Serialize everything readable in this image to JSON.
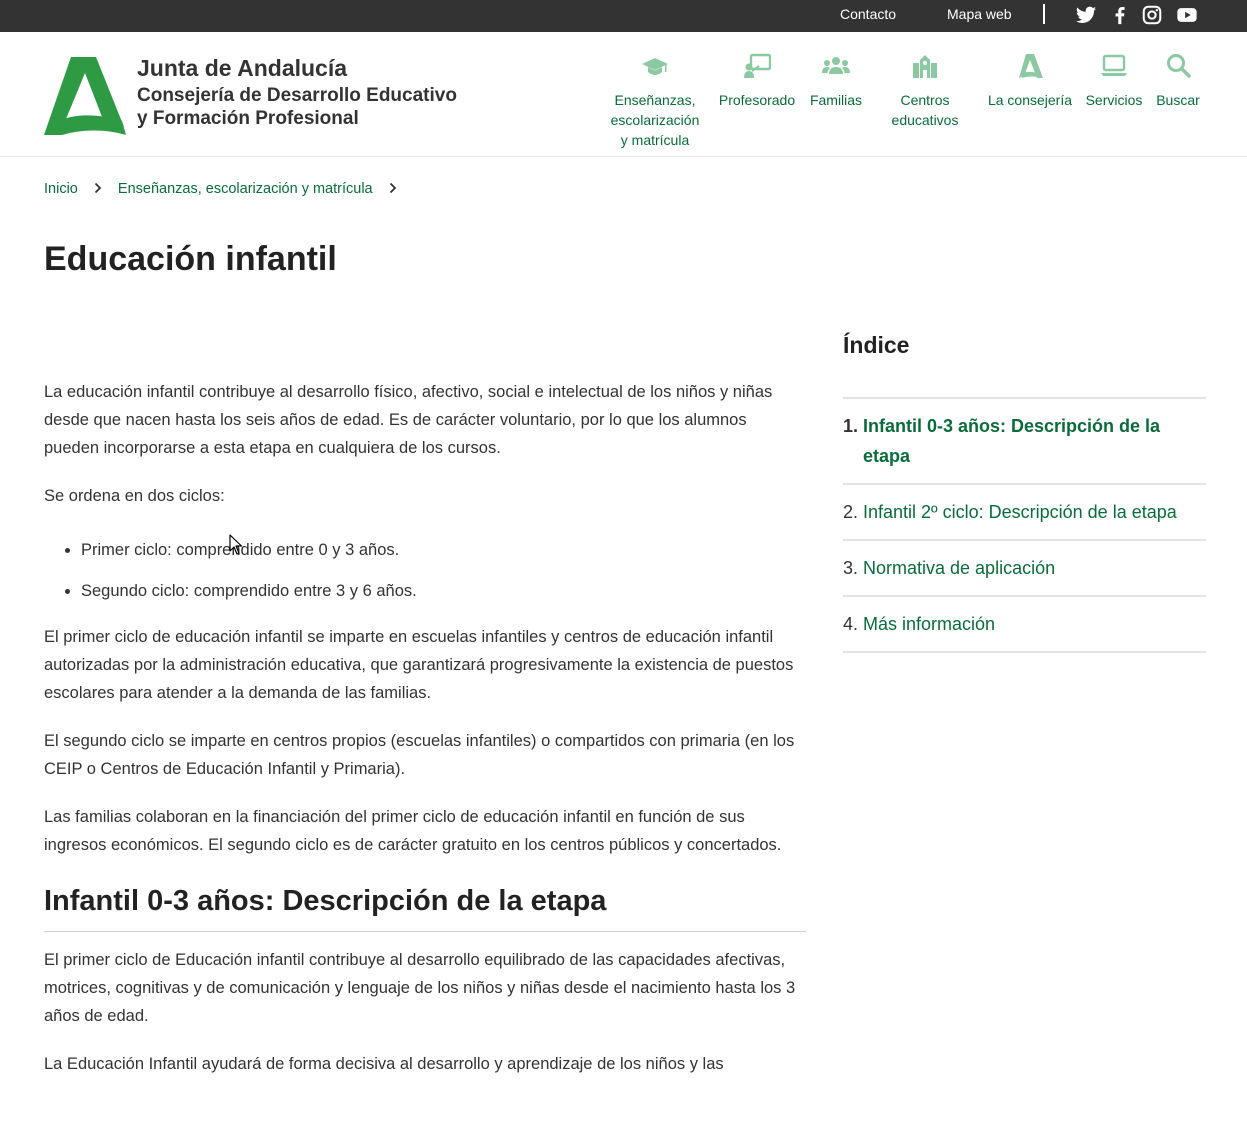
{
  "topbar": {
    "links": [
      "Contacto",
      "Mapa web"
    ],
    "social": [
      {
        "icon": "twitter-icon"
      },
      {
        "icon": "facebook-icon"
      },
      {
        "icon": "instagram-icon"
      },
      {
        "icon": "youtube-icon"
      }
    ]
  },
  "header": {
    "logo_lines": [
      "Junta de Andalucía",
      "Consejería de Desarrollo Educativo",
      "y Formación Profesional"
    ],
    "nav": [
      {
        "lines": [
          "Enseñanzas,",
          "escolarización",
          "y matrícula"
        ],
        "icon": "graduation-cap-icon"
      },
      {
        "lines": [
          "Profesorado"
        ],
        "icon": "teacher-board-icon"
      },
      {
        "lines": [
          "Familias"
        ],
        "icon": "family-icon"
      },
      {
        "lines": [
          "Centros",
          "educativos"
        ],
        "icon": "school-building-icon"
      },
      {
        "lines": [
          "La consejería"
        ],
        "icon": "andalucia-a-icon"
      },
      {
        "lines": [
          "Servicios"
        ],
        "icon": "laptop-icon"
      },
      {
        "lines": [
          "Buscar"
        ],
        "icon": "search-icon"
      }
    ]
  },
  "breadcrumb": [
    "Inicio",
    "Enseñanzas, escolarización y matrícula"
  ],
  "page_title": "Educación infantil",
  "content": {
    "intro": "La educación infantil contribuye al desarrollo físico, afectivo, social e intelectual de los niños y niñas desde que nacen hasta los seis años de edad. Es de carácter voluntario, por lo que los alumnos pueden incorporarse a esta etapa en cualquiera de los cursos.",
    "cycles_intro": "Se ordena en dos ciclos:",
    "cycles": [
      "Primer ciclo: comprendido entre 0 y 3 años.",
      "Segundo ciclo: comprendido entre 3 y 6 años."
    ],
    "p_first_cycle": "El primer ciclo de educación infantil se imparte en escuelas infantiles y centros de educación infantil autorizadas por la administración educativa, que garantizará progresivamente la existencia de puestos escolares para atender a la demanda de las familias.",
    "p_second_cycle": "El segundo ciclo se imparte en centros propios (escuelas infantiles) o compartidos con primaria (en los CEIP o Centros de Educación Infantil y Primaria).",
    "p_families": "Las familias colaboran en la financiación del primer ciclo de educación infantil en función de sus ingresos económicos. El segundo ciclo es de carácter gratuito en los centros públicos y concertados.",
    "section_title": "Infantil 0-3 años: Descripción de la etapa",
    "section_p1": "El primer ciclo de Educación infantil contribuye al desarrollo equilibrado de las capacidades afectivas, motrices, cognitivas y de comunicación y lenguaje de los niños y niñas desde el nacimiento hasta los 3 años de edad.",
    "section_p2": "La Educación Infantil ayudará de forma decisiva al desarrollo y aprendizaje de los niños y las"
  },
  "index": {
    "title": "Índice",
    "items": [
      {
        "num": "1.",
        "label": "Infantil 0-3 años: Descripción de la etapa",
        "active": true
      },
      {
        "num": "2.",
        "label": "Infantil 2º ciclo: Descripción de la etapa",
        "active": false
      },
      {
        "num": "3.",
        "label": "Normativa de aplicación",
        "active": false
      },
      {
        "num": "4.",
        "label": "Más información",
        "active": false
      }
    ]
  },
  "colors": {
    "brand_green": "#0b6b3a",
    "logo_green": "#2e9a44",
    "icon_green": "#8cc8a2",
    "topbar": "#333333"
  }
}
